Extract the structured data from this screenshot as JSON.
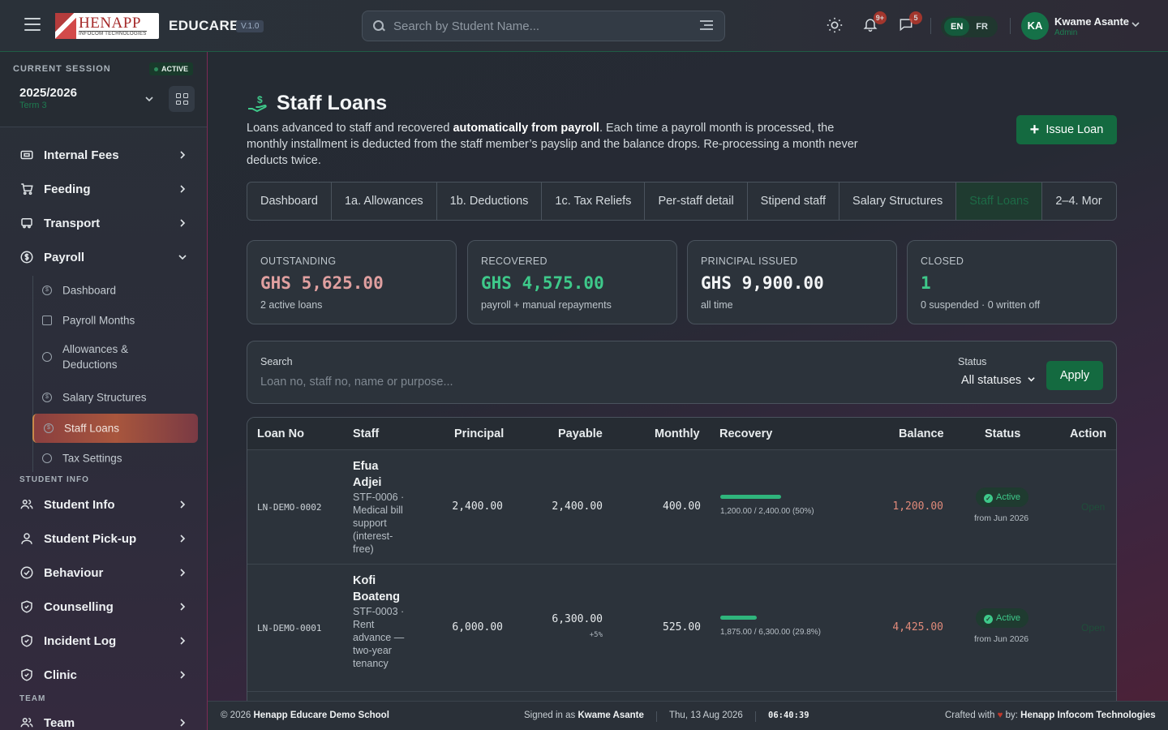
{
  "header": {
    "logo_main": "HENAPP",
    "logo_sub": "INFOCOM TECHNOLOGIES",
    "app_name": "EDUCARE",
    "version": "V.1.0",
    "search_placeholder": "Search by Student Name...",
    "notifications_badge": "9+",
    "messages_badge": "5",
    "languages": [
      "EN",
      "FR"
    ],
    "active_language": "EN",
    "user_initials": "KA",
    "user_name": "Kwame Asante",
    "user_role": "Admin"
  },
  "sidebar": {
    "session_label": "CURRENT SESSION",
    "session_status": "ACTIVE",
    "session_year": "2025/2026",
    "session_term": "Term 3",
    "top_items": [
      {
        "label": "Internal Fees",
        "icon": "ticket-icon"
      },
      {
        "label": "Feeding",
        "icon": "cart-icon"
      },
      {
        "label": "Transport",
        "icon": "bus-icon"
      },
      {
        "label": "Payroll",
        "icon": "dollar-circle-icon"
      }
    ],
    "payroll_sub": [
      {
        "label": "Dashboard"
      },
      {
        "label": "Payroll Months"
      },
      {
        "label": "Allowances & Deductions"
      },
      {
        "label": "Salary Structures"
      },
      {
        "label": "Staff Loans"
      },
      {
        "label": "Tax Settings"
      }
    ],
    "section_student_info": "STUDENT INFO",
    "student_items": [
      {
        "label": "Student Info"
      },
      {
        "label": "Student Pick-up"
      },
      {
        "label": "Behaviour"
      },
      {
        "label": "Counselling"
      },
      {
        "label": "Incident Log"
      },
      {
        "label": "Clinic"
      }
    ],
    "section_team": "TEAM",
    "team_items": [
      {
        "label": "Team"
      }
    ]
  },
  "page": {
    "title": "Staff Loans",
    "desc_before": "Loans advanced to staff and recovered ",
    "desc_bold": "automatically from payroll",
    "desc_after": ". Each time a payroll month is processed, the monthly installment is deducted from the staff member’s payslip and the balance drops. Re-processing a month never deducts twice.",
    "issue_button": "Issue Loan",
    "tabs": [
      "Dashboard",
      "1a. Allowances",
      "1b. Deductions",
      "1c. Tax Reliefs",
      "Per-staff detail",
      "Stipend staff",
      "Salary Structures",
      "Staff Loans",
      "2–4. Mor"
    ],
    "active_tab": "Staff Loans"
  },
  "stats": [
    {
      "label": "OUTSTANDING",
      "value": "GHS 5,625.00",
      "sub": "2 active loans",
      "color": "#e0a0a0"
    },
    {
      "label": "RECOVERED",
      "value": "GHS 4,575.00",
      "sub": "payroll + manual repayments",
      "color": "#3ec98a"
    },
    {
      "label": "PRINCIPAL ISSUED",
      "value": "GHS 9,900.00",
      "sub": "all time",
      "color": "#f3f5f6"
    },
    {
      "label": "CLOSED",
      "value": "1",
      "sub": "0 suspended · 0 written off",
      "color": "#3ec98a"
    }
  ],
  "filters": {
    "search_label": "Search",
    "search_placeholder": "Loan no, staff no, name or purpose...",
    "status_label": "Status",
    "status_value": "All statuses",
    "apply_button": "Apply"
  },
  "table": {
    "columns": [
      "Loan No",
      "Staff",
      "Principal",
      "Payable",
      "Monthly",
      "Recovery",
      "Balance",
      "Status",
      "Action"
    ],
    "rows": [
      {
        "loan_no": "LN-DEMO-0002",
        "staff_first": "Efua",
        "staff_last": "Adjei",
        "staff_meta": "STF-0006 · Medical bill support (interest-free)",
        "principal": "2,400.00",
        "payable": "2,400.00",
        "payable_note": "",
        "monthly": "400.00",
        "recovery_fraction": 0.5,
        "recovery_text": "1,200.00 / 2,400.00 (50%)",
        "balance": "1,200.00",
        "status": "Active",
        "status_from": "from Jun 2026",
        "action": "Open"
      },
      {
        "loan_no": "LN-DEMO-0001",
        "staff_first": "Kofi",
        "staff_last": "Boateng",
        "staff_meta": "STF-0003 · Rent advance — two-year tenancy",
        "principal": "6,000.00",
        "payable": "6,300.00",
        "payable_note": "+5%",
        "monthly": "525.00",
        "recovery_fraction": 0.298,
        "recovery_text": "1,875.00 / 6,300.00 (29.8%)",
        "balance": "4,425.00",
        "status": "Active",
        "status_from": "from Jun 2026",
        "action": "Open"
      }
    ]
  },
  "footer": {
    "copyright": "© 2026",
    "school": "Henapp Educare Demo School",
    "signed_in_prefix": "Signed in as",
    "signed_in_user": "Kwame Asante",
    "date": "Thu, 13 Aug 2026",
    "time": "06:40:39",
    "crafted_prefix": "Crafted with",
    "crafted_by": "by:",
    "company": "Henapp Infocom Technologies"
  }
}
